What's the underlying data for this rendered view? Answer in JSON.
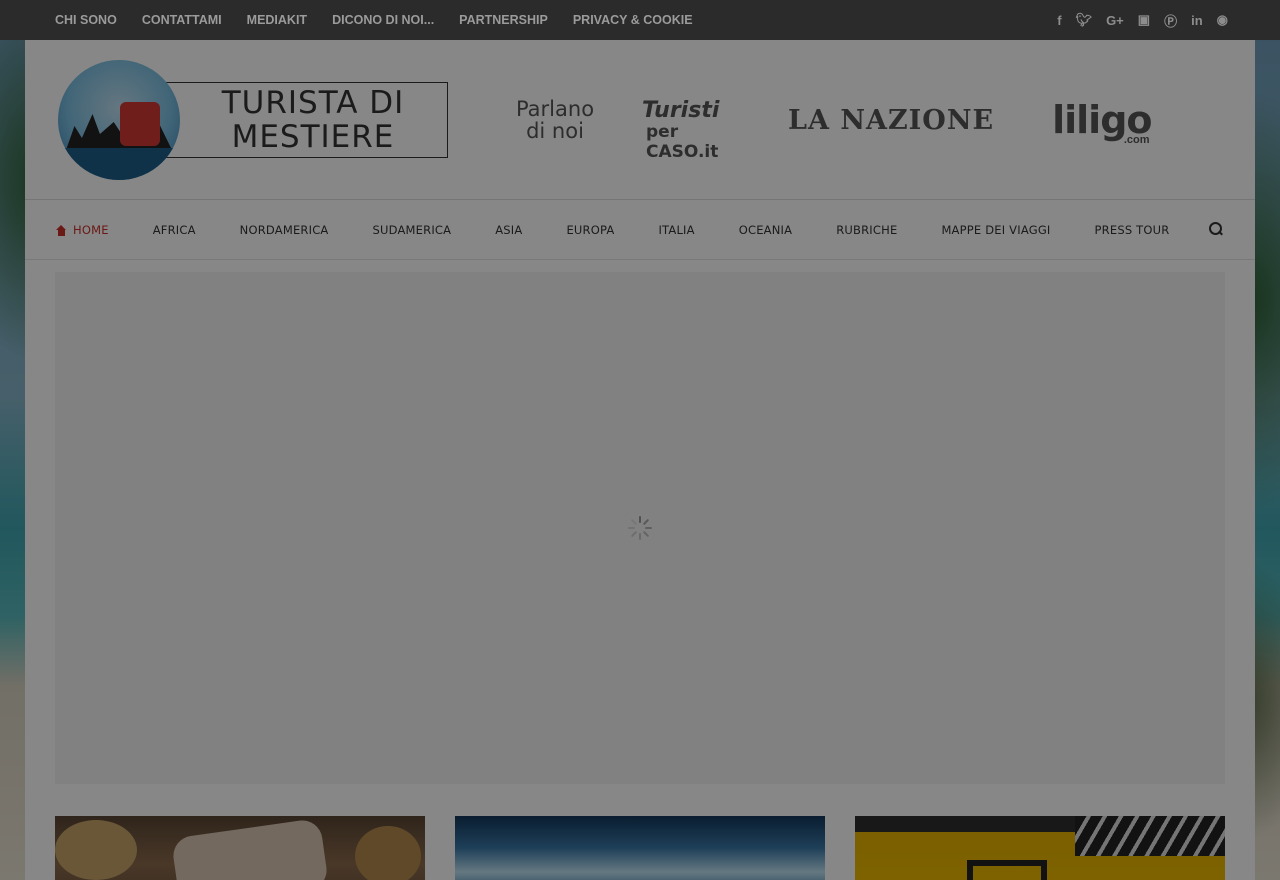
{
  "topbar": {
    "links": [
      "CHI SONO",
      "CONTATTAMI",
      "MEDIAKIT",
      "DICONO DI NOI...",
      "PARTNERSHIP",
      "PRIVACY & COOKIE"
    ],
    "social_icons": [
      "facebook-icon",
      "twitter-icon",
      "google-plus-icon",
      "instagram-icon",
      "pinterest-icon",
      "linkedin-icon",
      "flickr-icon"
    ]
  },
  "logo": {
    "line1": "TURISTA DI",
    "line2": "MESTIERE"
  },
  "press": {
    "label_line1": "Parlano",
    "label_line2": "di noi",
    "tpc_word1": "Turisti",
    "tpc_word2": "per CASO.it",
    "nazione": "LA NAZIONE",
    "liligo": "liligo",
    "liligo_com": ".com"
  },
  "nav": {
    "items": [
      "HOME",
      "AFRICA",
      "NORDAMERICA",
      "SUDAMERICA",
      "ASIA",
      "EUROPA",
      "ITALIA",
      "OCEANIA",
      "RUBRICHE",
      "MAPPE DEI VIAGGI",
      "PRESS TOUR"
    ]
  },
  "colors": {
    "accent": "#c9302c",
    "topbar_bg": "#2b2b2b"
  }
}
